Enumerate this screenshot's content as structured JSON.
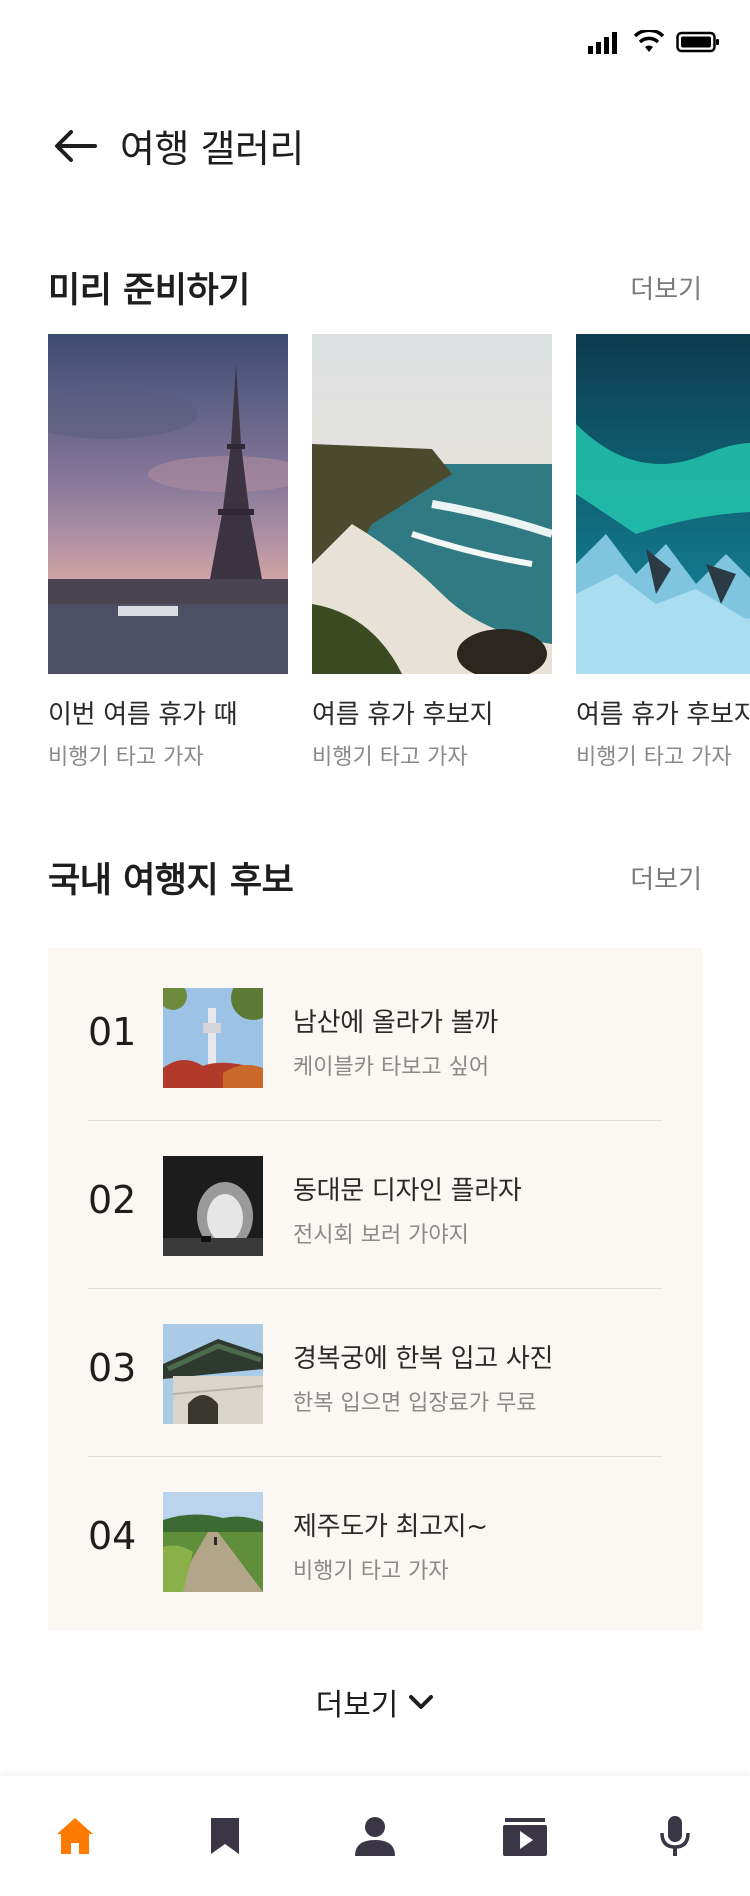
{
  "header": {
    "title": "여행 갤러리"
  },
  "preparation": {
    "title": "미리 준비하기",
    "more_label": "더보기",
    "cards": [
      {
        "title": "이번 여름 휴가 때",
        "subtitle": "비행기 타고 가자",
        "image": "eiffel-tower-photo"
      },
      {
        "title": "여름 휴가 후보지",
        "subtitle": "비행기 타고 가자",
        "image": "beach-coast-photo"
      },
      {
        "title": "여름 휴가 후보지",
        "subtitle": "비행기 타고 가자",
        "image": "aurora-glacier-photo"
      }
    ]
  },
  "domestic": {
    "title": "국내 여행지 후보",
    "more_label": "더보기",
    "items": [
      {
        "rank": "01",
        "title": "남산에 올라가 볼까",
        "subtitle": "케이블카 타보고 싶어",
        "image": "namsan-tower-photo"
      },
      {
        "rank": "02",
        "title": "동대문 디자인 플라자",
        "subtitle": "전시회 보러 가야지",
        "image": "ddp-tunnel-photo"
      },
      {
        "rank": "03",
        "title": "경복궁에 한복 입고 사진",
        "subtitle": "한복 입으면 입장료가 무료",
        "image": "gyeongbokgung-gate-photo"
      },
      {
        "rank": "04",
        "title": "제주도가 최고지~",
        "subtitle": "비행기 타고 가자",
        "image": "jeju-path-photo"
      }
    ]
  },
  "load_more": {
    "label": "더보기"
  },
  "nav": {
    "items": [
      {
        "icon": "home-icon",
        "active": true
      },
      {
        "icon": "bookmark-icon",
        "active": false
      },
      {
        "icon": "profile-icon",
        "active": false
      },
      {
        "icon": "media-icon",
        "active": false
      },
      {
        "icon": "microphone-icon",
        "active": false
      }
    ],
    "active_color": "#ff7a00",
    "inactive_color": "#3a3645"
  }
}
